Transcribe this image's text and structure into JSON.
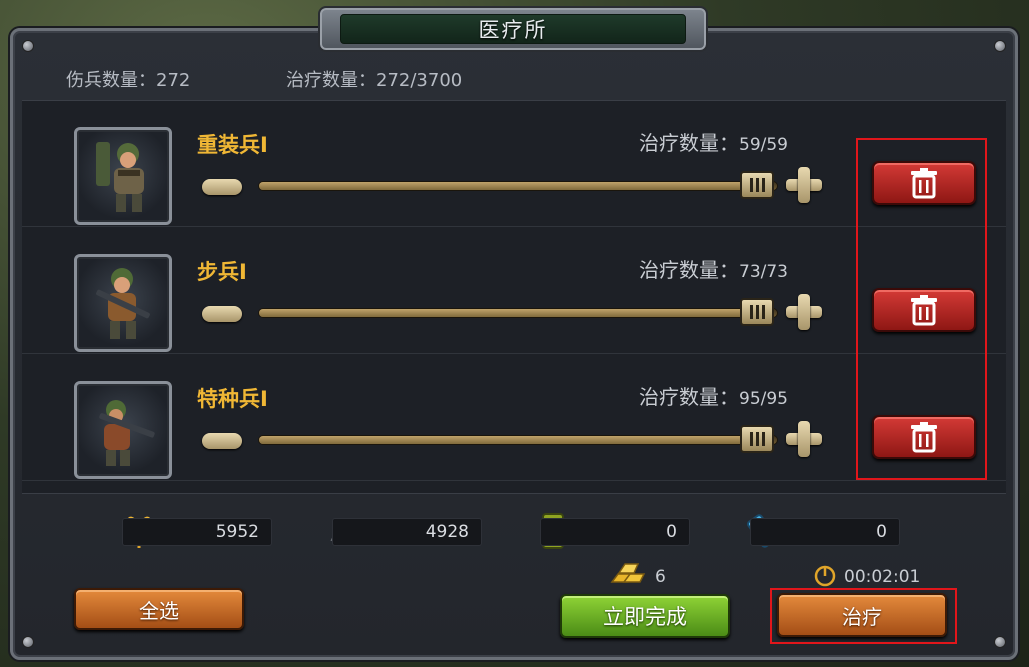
{
  "header": {
    "title": "医疗所"
  },
  "summary": {
    "wounded_label": "伤兵数量：272",
    "heal_label": "治疗数量：272/3700"
  },
  "units": [
    {
      "name": "重装兵I",
      "count_label": "治疗数量：",
      "count_value": "59/59",
      "selected": 59,
      "max": 59,
      "icon": "heavy-soldier-icon"
    },
    {
      "name": "步兵I",
      "count_label": "治疗数量：",
      "count_value": "73/73",
      "selected": 73,
      "max": 73,
      "icon": "infantry-soldier-icon"
    },
    {
      "name": "特种兵I",
      "count_label": "治疗数量：",
      "count_value": "95/95",
      "selected": 95,
      "max": 95,
      "icon": "special-forces-icon"
    }
  ],
  "resources": [
    {
      "icon": "wheat-icon",
      "value": "5952"
    },
    {
      "icon": "steel-ore-icon",
      "value": "4928"
    },
    {
      "icon": "oil-barrel-icon",
      "value": "0"
    },
    {
      "icon": "crystal-icon",
      "value": "0"
    }
  ],
  "cost": {
    "gold_icon": "gold-bars-icon",
    "gold_value": "6",
    "time_icon": "timer-icon",
    "time_value": "00:02:01"
  },
  "buttons": {
    "select_all": "全选",
    "instant_finish": "立即完成",
    "heal": "治疗"
  },
  "colors": {
    "unit_name": "#f0b735",
    "delete_red": "#c4302b",
    "finish_green": "#6fb526",
    "heal_orange": "#c9692a",
    "highlight": "#e1161b"
  }
}
